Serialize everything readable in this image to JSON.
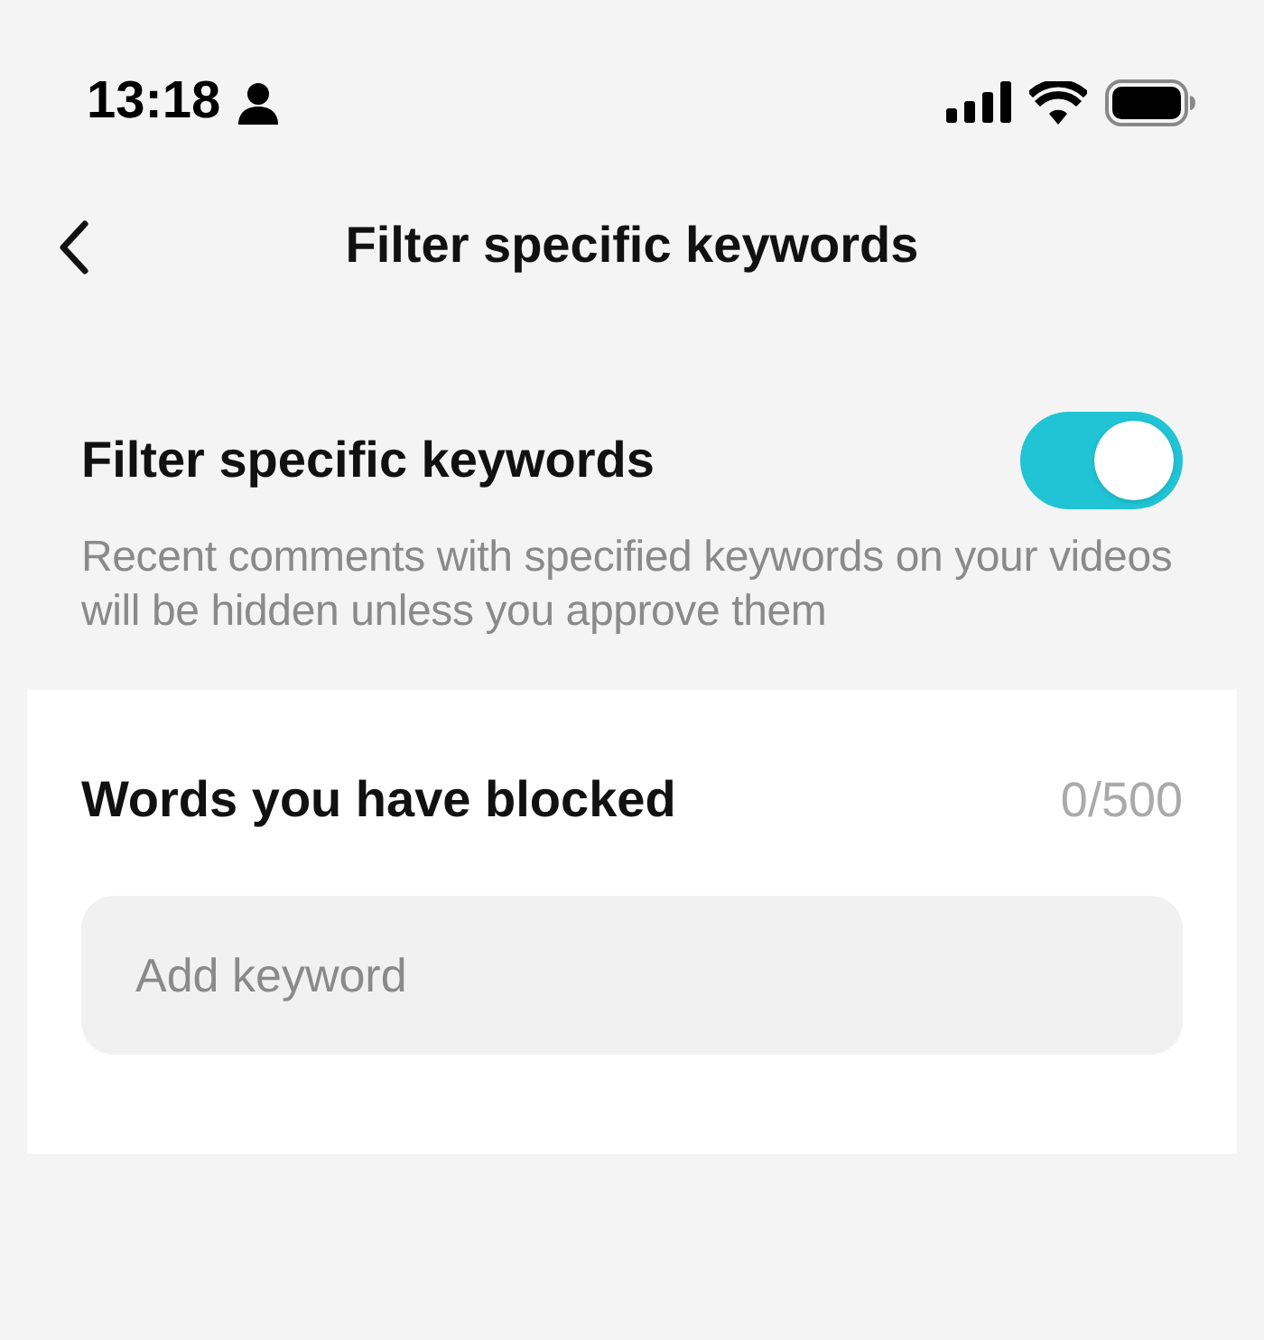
{
  "status_bar": {
    "time": "13:18"
  },
  "header": {
    "title": "Filter specific keywords"
  },
  "filter_setting": {
    "label": "Filter specific keywords",
    "on": true,
    "description": "Recent comments with specified keywords on your videos will be hidden unless you approve them"
  },
  "blocked_words": {
    "title": "Words you have blocked",
    "count": "0/500",
    "input": {
      "placeholder": "Add keyword"
    }
  }
}
